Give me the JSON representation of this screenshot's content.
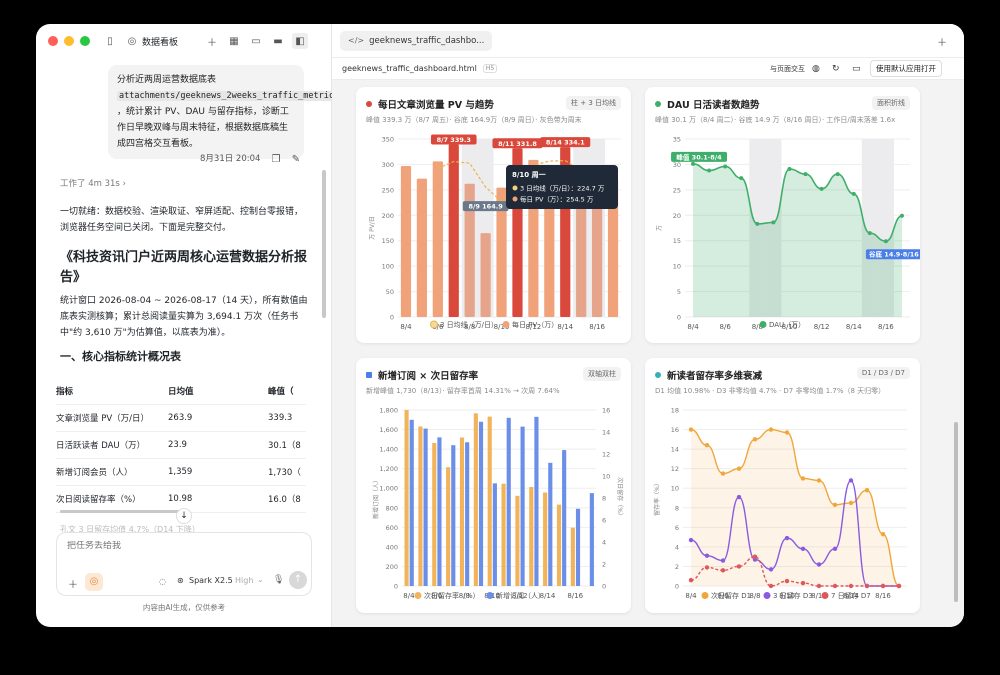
{
  "sidebar_top": {
    "title": "数据看板"
  },
  "chat": {
    "user_msg_parts": [
      "分析近两周运营数据底表",
      "attachments/geeknews_2weeks_traffic_metrics.csv",
      "，统计累计 PV、DAU 与留存指标，诊断工作日早晚双峰与周末特征，根据数据底稿生成四宫格交互看板。"
    ],
    "timestamp": "8月31日 20:04",
    "worked": "工作了 4m 31s",
    "ready_text": "一切就绪：数据校验、渲染取证、窄屏适配、控制台零报错，浏览器任务空间已关闭。下面是完整交付。",
    "report_title": "《科技资讯门户近两周核心运营数据分析报告》",
    "report_intro": "统计窗口 2026-08-04 ~ 2026-08-17（14 天），所有数值由底表实测核算；累计总阅读量实算为 3,694.1 万次（任务书中\"约 3,610 万\"为估算值，以底表为准）。",
    "section1": "一、核心指标统计概况表",
    "table": {
      "headers": [
        "指标",
        "日均值",
        "峰值（"
      ],
      "rows": [
        [
          "文章浏览量 PV（万/日）",
          "263.9",
          "339.3"
        ],
        [
          "日活跃读者 DAU（万）",
          "23.9",
          "30.1（8"
        ],
        [
          "新增订阅会员（人）",
          "1,359",
          "1,730（"
        ],
        [
          "次日阅读留存率（%）",
          "10.98",
          "16.0（8"
        ]
      ]
    },
    "trailing": "孔文 3 日留存均值 4.7%（D14 下降）",
    "input_placeholder": "把任务丢给我",
    "model": "Spark X2.5",
    "mode": "High",
    "footer": "内容由AI生成，仅供参考"
  },
  "viewer": {
    "tab_title": "geeknews_traffic_dashbo...",
    "file_name": "geeknews_traffic_dashboard.html",
    "file_badge": "H5",
    "interact_label": "与页面交互",
    "open_label": "使用默认应用打开"
  },
  "charts": {
    "pv": {
      "title": "每日文章浏览量 PV 与趋势",
      "badge": "柱 + 3 日均线",
      "subtitle": "峰值 339.3 万（8/7 周五）· 谷底 164.9万（8/9 周日）· 灰色带为周末",
      "tooltip_title": "8/10 周一",
      "tooltip_l1": "3 日均线（万/日）：224.7 万",
      "tooltip_l2": "每日 PV（万）：254.5 万",
      "label_peak": "8/7 339.3",
      "label_low": "8/9 164.9",
      "label_8_11": "8/11 331.8",
      "label_8_14": "8/14 334.1",
      "ylabel": "万 PV/日",
      "legend": [
        "3 日均线（万/日）",
        "每日 PV（万）"
      ]
    },
    "dau": {
      "title": "DAU 日活读者数趋势",
      "badge": "面积折线",
      "subtitle": "峰值 30.1 万（8/4 周二）· 谷底 14.9 万（8/16 周日）· 工作日/周末落差 1.6x",
      "label_peak": "峰值 30.1·8/4",
      "label_low": "谷底 14.9·8/16",
      "ylabel": "万",
      "legend": [
        "DAU（万）"
      ]
    },
    "sub": {
      "title": "新增订阅 × 次日留存率",
      "badge": "双轴双柱",
      "subtitle": "新增峰值 1,730（8/13）· 留存率首周 14.31% → 次周 7.64%",
      "ylabel_left": "新增订阅（人）",
      "ylabel_right": "次日留存（%）",
      "legend": [
        "次日留存率（%）",
        "新增订阅（人）"
      ]
    },
    "ret": {
      "title": "新读者留存率多维衰减",
      "badge": "D1 / D3 / D7",
      "subtitle": "D1 均值 10.98% · D3 非零均值 4.7% · D7 非零均值 1.7%（8 天归零）",
      "ylabel": "留存率（%）",
      "legend": [
        "次日留存 D1",
        "3 日留存 D3",
        "7 日留存 D7"
      ]
    }
  },
  "chart_data": [
    {
      "type": "bar",
      "title": "每日文章浏览量 PV 与趋势",
      "ylabel": "万 PV/日",
      "ylim": [
        0,
        350
      ],
      "categories": [
        "8/4",
        "8/5",
        "8/6",
        "8/7",
        "8/8",
        "8/9",
        "8/10",
        "8/11",
        "8/12",
        "8/13",
        "8/14",
        "8/15",
        "8/16",
        "8/17"
      ],
      "series": [
        {
          "name": "每日 PV（万）",
          "values": [
            297,
            272,
            306,
            339.3,
            262,
            164.9,
            254.5,
            331.8,
            309,
            279,
            334.1,
            255,
            262,
            271
          ]
        },
        {
          "name": "3 日均线（万/日）",
          "values": [
            null,
            null,
            291.7,
            305.8,
            302.4,
            255.4,
            227.1,
            250.4,
            298.4,
            306.6,
            307.4,
            289.4,
            283.7,
            262.7
          ]
        }
      ]
    },
    {
      "type": "area",
      "title": "DAU 日活读者数趋势",
      "ylabel": "万",
      "ylim": [
        0,
        35
      ],
      "categories": [
        "8/4",
        "8/5",
        "8/6",
        "8/7",
        "8/8",
        "8/9",
        "8/10",
        "8/11",
        "8/12",
        "8/13",
        "8/14",
        "8/15",
        "8/16",
        "8/17"
      ],
      "series": [
        {
          "name": "DAU（万）",
          "values": [
            30.1,
            28.8,
            29.6,
            27.3,
            18.3,
            18.6,
            29.1,
            28.1,
            25.2,
            28.1,
            24.2,
            16.5,
            14.9,
            19.9
          ]
        }
      ]
    },
    {
      "type": "bar",
      "title": "新增订阅 × 次日留存率",
      "ylim": [
        0,
        1800
      ],
      "categories": [
        "8/4",
        "8/5",
        "8/6",
        "8/7",
        "8/8",
        "8/9",
        "8/10",
        "8/11",
        "8/12",
        "8/13",
        "8/14",
        "8/15",
        "8/16",
        "8/17"
      ],
      "series": [
        {
          "name": "次日留存率（%）",
          "values": [
            16.0,
            14.5,
            13.0,
            10.8,
            13.5,
            15.7,
            15.4,
            9.3,
            8.2,
            9.0,
            8.5,
            7.4,
            5.3,
            0
          ]
        },
        {
          "name": "新增订阅（人）",
          "values": [
            1700,
            1610,
            1520,
            1440,
            1470,
            1680,
            1050,
            1720,
            1630,
            1730,
            1260,
            1390,
            790,
            950
          ]
        }
      ]
    },
    {
      "type": "line",
      "title": "新读者留存率多维衰减",
      "ylabel": "留存率（%）",
      "ylim": [
        0,
        18
      ],
      "categories": [
        "8/4",
        "8/5",
        "8/6",
        "8/7",
        "8/8",
        "8/9",
        "8/10",
        "8/11",
        "8/12",
        "8/13",
        "8/14",
        "8/15",
        "8/16",
        "8/17"
      ],
      "series": [
        {
          "name": "次日留存 D1",
          "values": [
            16.0,
            14.4,
            11.5,
            12.0,
            15.0,
            16.0,
            15.7,
            11.0,
            10.8,
            8.3,
            8.5,
            9.8,
            5.3,
            0
          ]
        },
        {
          "name": "3 日留存 D3",
          "values": [
            4.7,
            3.1,
            2.6,
            9.1,
            2.7,
            1.7,
            4.9,
            3.8,
            2.2,
            3.8,
            10.8,
            0,
            0,
            0
          ]
        },
        {
          "name": "7 日留存 D7",
          "values": [
            0.6,
            1.9,
            1.6,
            2.0,
            3.0,
            0,
            0.5,
            0.3,
            0,
            0,
            0,
            0,
            0,
            0
          ]
        }
      ]
    }
  ]
}
